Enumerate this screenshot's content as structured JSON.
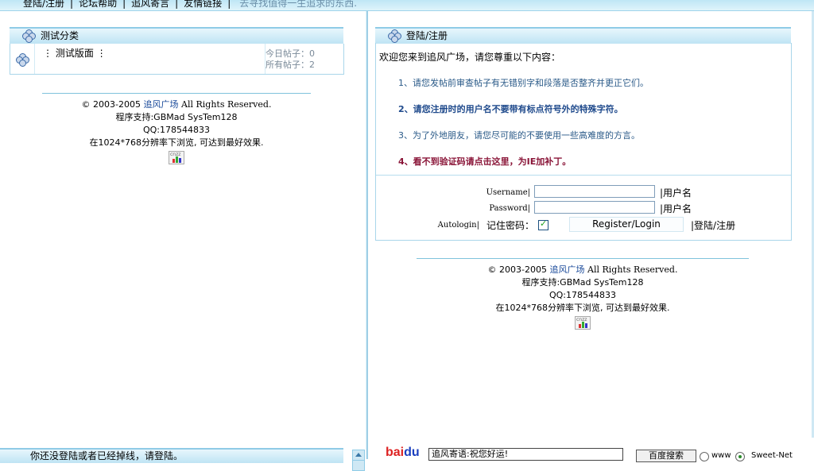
{
  "topnav": {
    "links": [
      "登陆/注册",
      "论坛帮助",
      "追风寄言",
      "友情链接"
    ],
    "slogan": "去寻找值得一生追求的东西."
  },
  "left": {
    "category": {
      "title": "测试分类",
      "forum_name": "测试版面",
      "today_posts": "今日帖子：0",
      "all_posts": "所有帖子：2"
    },
    "footer": {
      "copyright_pre": "© 2003-2005",
      "site": "追风广场",
      "copyright_post": "All Rights Reserved.",
      "program": "程序支持:GBMad SysTem128",
      "qq": "QQ:178544833",
      "resolution": "在1024*768分辨率下浏览, 可达到最好效果.",
      "badge": "cnzz"
    },
    "status": "你还没登陆或者已经掉线，请登陆。"
  },
  "right": {
    "login": {
      "title": "登陆/注册",
      "welcome": "欢迎您来到追风广场，请您尊重以下内容：",
      "rules": [
        "1、请您发帖前审查帖子有无错别字和段落是否整齐并更正它们。",
        "2、请您注册时的用户名不要带有标点符号外的特殊字符。",
        "3、为了外地朋友，请您尽可能的不要使用一些高难度的方言。",
        "4、看不到验证码请点击这里，为IE加补丁。"
      ],
      "username_label": "Username|",
      "username_hint": "|用户名",
      "password_label": "Password|",
      "password_hint": "|用户名",
      "autologin_label": "Autologin|",
      "remember_label": "记住密码：",
      "submit_label": "Register/Login",
      "submit_hint": "|登陆/注册"
    },
    "footer": {
      "copyright_pre": "© 2003-2005",
      "site": "追风广场",
      "copyright_post": "All Rights Reserved.",
      "program": "程序支持:GBMad SysTem128",
      "qq": "QQ:178544833",
      "resolution": "在1024*768分辨率下浏览, 可达到最好效果.",
      "badge": "cnzz"
    },
    "baidu": {
      "logo_bai": "bai",
      "logo_du": "du",
      "input_value": "追风寄语:祝您好运!",
      "button": "百度搜索",
      "opt_www": "www",
      "opt_site": "Sweet-Net"
    }
  },
  "colors": {
    "header_border": "#8fcbe6",
    "rule_normal": "#2a5a88",
    "rule_red": "#8a1538"
  }
}
